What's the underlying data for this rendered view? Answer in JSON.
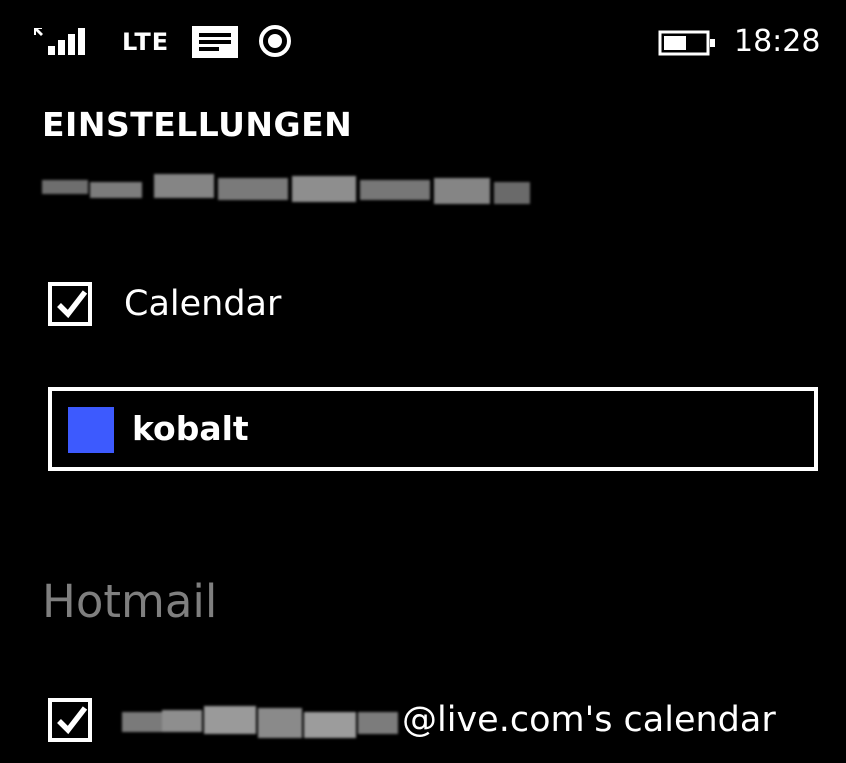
{
  "status_bar": {
    "network": "LTE",
    "time": "18:28",
    "icons": [
      "signal-icon",
      "lte-icon",
      "message-icon",
      "location-icon",
      "battery-icon"
    ]
  },
  "header": {
    "title": "EINSTELLUNGEN"
  },
  "calendar_toggle": {
    "label": "Calendar",
    "checked": true
  },
  "color_picker": {
    "value": "kobalt",
    "swatch_color": "#3d5afe"
  },
  "section": {
    "title": "Hotmail"
  },
  "account_calendar": {
    "label_suffix": "@live.com's calendar",
    "checked": true
  },
  "colors": {
    "background": "#000000",
    "foreground": "#ffffff",
    "subtle": "#7f7f7f",
    "accent": "#3d5afe"
  }
}
